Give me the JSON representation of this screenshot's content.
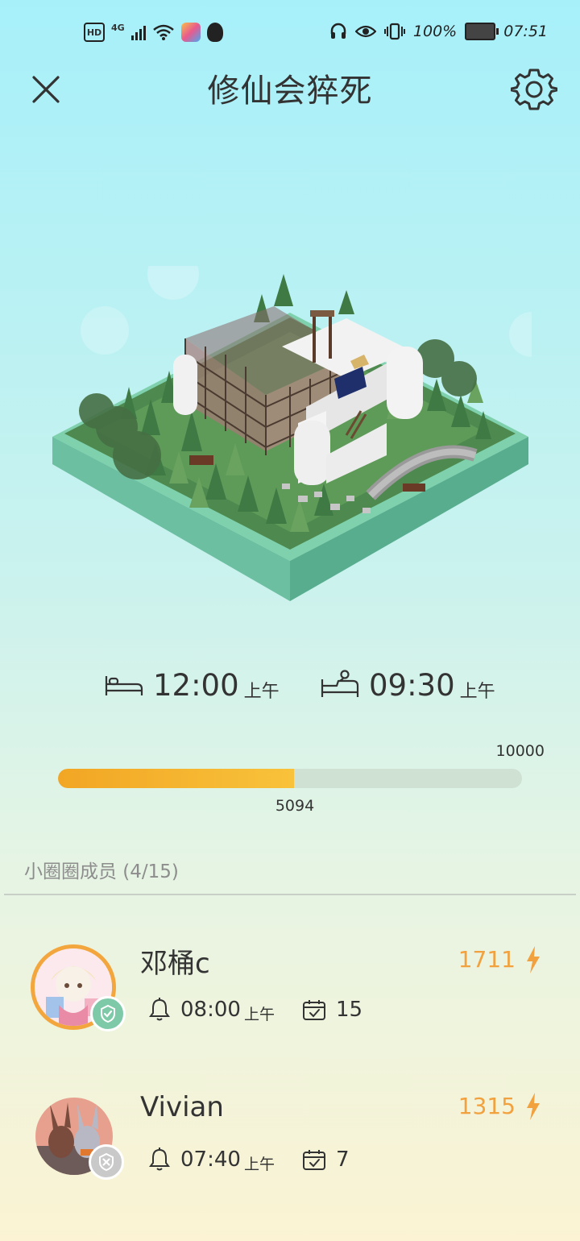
{
  "status_bar": {
    "left": {
      "hd": "HD",
      "network": "4G"
    },
    "battery": "100%",
    "time": "07:51"
  },
  "header": {
    "title": "修仙会猝死",
    "close_icon": "close-icon",
    "settings_icon": "gear-icon"
  },
  "sleep": {
    "bedtime": "12:00",
    "bedtime_period": "上午",
    "wake": "09:30",
    "wake_period": "上午"
  },
  "progress": {
    "max": "10000",
    "value": "5094",
    "fraction": 0.5094,
    "colors": {
      "fill": "#f2a624",
      "track": "#cfe1d2"
    }
  },
  "members": {
    "title": "小圈圈成员 (4/15)",
    "items": [
      {
        "name": "邓桶c",
        "score": "1711",
        "alarm": "08:00",
        "alarm_period": "上午",
        "days": "15",
        "status": "checked"
      },
      {
        "name": "Vivian",
        "score": "1315",
        "alarm": "07:40",
        "alarm_period": "上午",
        "days": "7",
        "status": "off"
      }
    ]
  },
  "colors": {
    "accent": "#f2a13f",
    "text": "#333333",
    "muted": "#8d8d8d",
    "badge_green": "#7ec9a8",
    "badge_gray": "#c9c9c9"
  }
}
